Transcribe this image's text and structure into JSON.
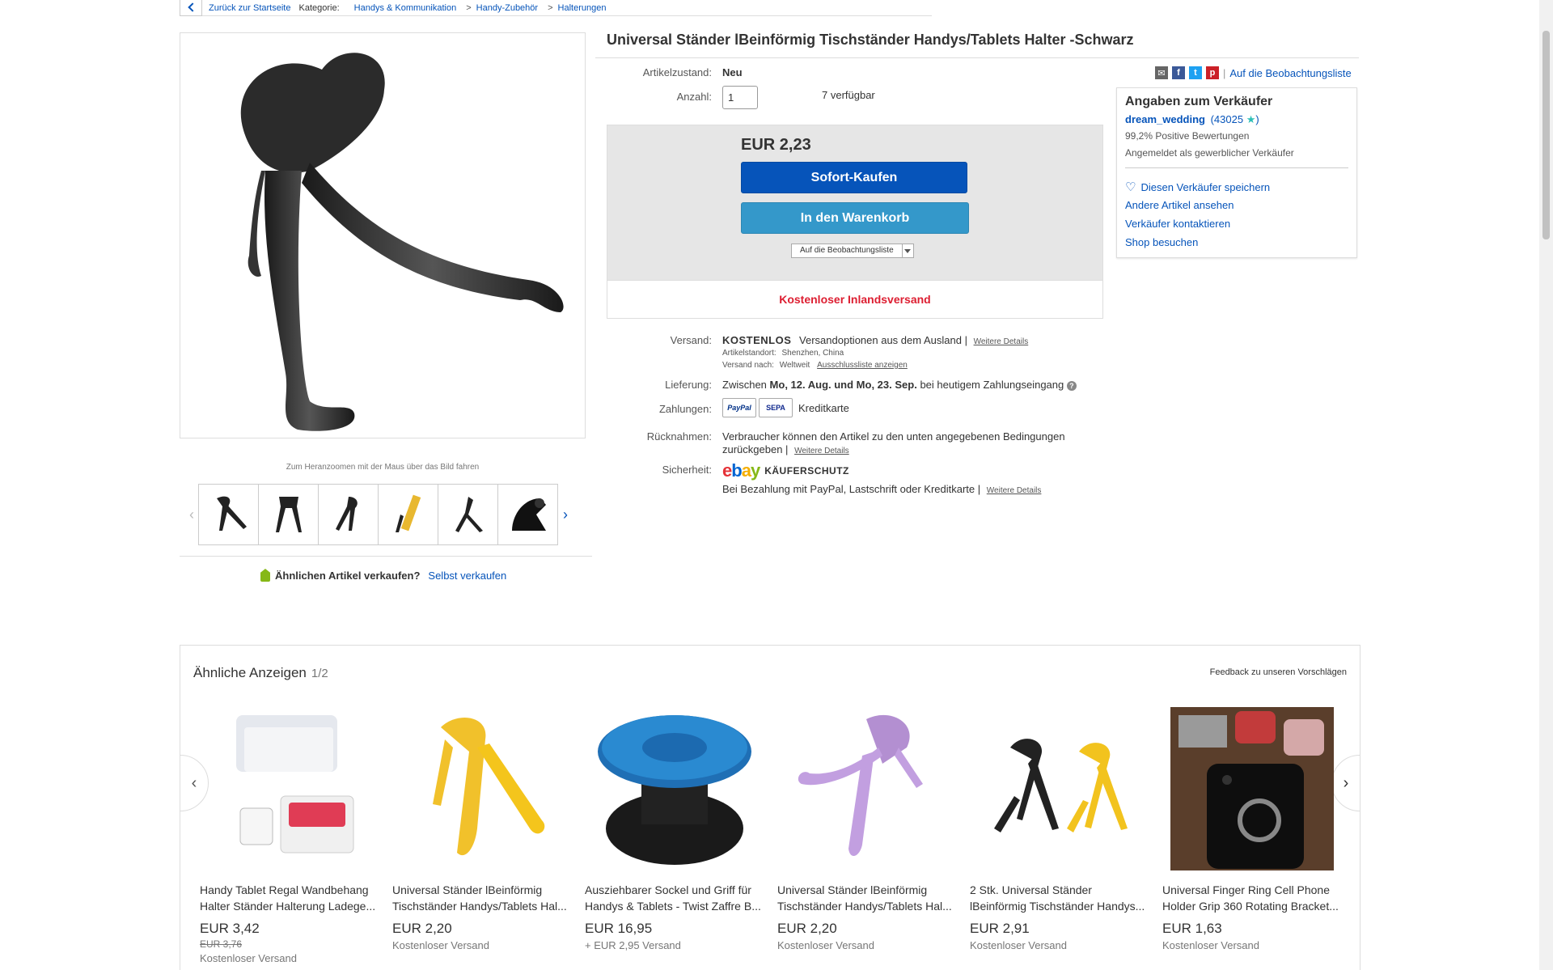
{
  "breadcrumb": {
    "back": "Zurück zur Startseite",
    "category_label": "Kategorie:",
    "items": [
      "Handys & Kommunikation",
      "Handy-Zubehör",
      "Halterungen"
    ],
    "separator": ">"
  },
  "gallery": {
    "caption": "Zum Heranzoomen mit der Maus über das Bild fahren",
    "thumb_prev": "‹",
    "thumb_next": "›"
  },
  "sell_similar": {
    "question": "Ähnlichen Artikel verkaufen?",
    "link": "Selbst verkaufen"
  },
  "item": {
    "title": "Universal Ständer lBeinförmig Tischständer Handys/Tablets Halter -Schwarz",
    "condition_label": "Artikelzustand:",
    "condition": "Neu",
    "qty_label": "Anzahl:",
    "qty_value": "1",
    "available": "7 verfügbar"
  },
  "buy_box": {
    "price": "EUR 2,23",
    "buy_now": "Sofort-Kaufen",
    "add_cart": "In den Warenkorb",
    "watch": "Auf die Beobachtungsliste",
    "free_shipping": "Kostenloser Inlandsversand"
  },
  "share": {
    "watch_link": "Auf die Beobachtungsliste",
    "sep": "|"
  },
  "seller": {
    "title": "Angaben zum Verkäufer",
    "name": "dream_wedding",
    "rating": "(43025",
    "rating_close": ")",
    "positive": "99,2% Positive Bewertungen",
    "registered": "Angemeldet als gewerblicher Verkäufer",
    "save": "Diesen Verkäufer speichern",
    "other_items": "Andere Artikel ansehen",
    "contact": "Verkäufer kontaktieren",
    "shop": "Shop besuchen"
  },
  "details": {
    "shipping_label": "Versand:",
    "shipping_free": "KOSTENLOS",
    "shipping_options": "Versandoptionen aus dem Ausland |",
    "more_details": "Weitere Details",
    "location_label": "Artikelstandort:",
    "location": "Shenzhen, China",
    "ship_to_label": "Versand nach:",
    "ship_to": "Weltweit",
    "exclusions": "Ausschlussliste anzeigen",
    "delivery_label": "Lieferung:",
    "delivery_pre": "Zwischen",
    "delivery_dates": "Mo, 12. Aug. und Mo, 23. Sep.",
    "delivery_post": "bei heutigem Zahlungseingang",
    "payment_label": "Zahlungen:",
    "paypal": "PayPal",
    "sepa": "SEPA",
    "credit_card": "Kreditkarte",
    "returns_label": "Rücknahmen:",
    "returns_text_1": "Verbraucher können den Artikel zu den unten angegebenen Bedingungen",
    "returns_text_2": "zurückgeben |",
    "security_label": "Sicherheit:",
    "ebay_logo": "ebay",
    "protection": "KÄUFERSCHUTZ",
    "security_text": "Bei Bezahlung mit PayPal, Lastschrift oder Kreditkarte |"
  },
  "similar": {
    "title": "Ähnliche Anzeigen",
    "page": "1/2",
    "feedback": "Feedback zu unseren Vorschlägen",
    "cards": [
      {
        "title": "Handy Tablet Regal Wandbehang Halter Ständer Halterung Ladege...",
        "price": "EUR 3,42",
        "old_price": "EUR 3,76",
        "shipping": "Kostenloser Versand"
      },
      {
        "title": "Universal Ständer lBeinförmig Tischständer Handys/Tablets Hal...",
        "price": "EUR 2,20",
        "old_price": "",
        "shipping": "Kostenloser Versand"
      },
      {
        "title": "Ausziehbarer Sockel und Griff für Handys & Tablets - Twist Zaffre B...",
        "price": "EUR 16,95",
        "old_price": "",
        "shipping": "+ EUR 2,95 Versand"
      },
      {
        "title": "Universal Ständer lBeinförmig Tischständer Handys/Tablets Hal...",
        "price": "EUR 2,20",
        "old_price": "",
        "shipping": "Kostenloser Versand"
      },
      {
        "title": "2 Stk. Universal Ständer lBeinförmig Tischständer Handys...",
        "price": "EUR 2,91",
        "old_price": "",
        "shipping": "Kostenloser Versand"
      },
      {
        "title": "Universal Finger Ring Cell Phone Holder Grip 360 Rotating Bracket...",
        "price": "EUR 1,63",
        "old_price": "",
        "shipping": "Kostenloser Versand"
      }
    ]
  },
  "colors": {
    "link": "#0654ba",
    "buy_now": "#0654ba",
    "add_cart": "#3498ca",
    "free_shipping": "#dd1e31"
  }
}
